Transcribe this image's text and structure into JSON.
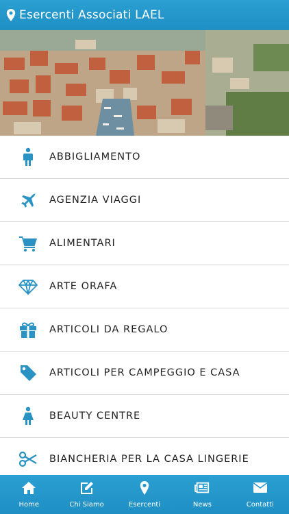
{
  "header": {
    "title": "Esercenti Associati LAEL",
    "icon": "map-marker-icon"
  },
  "hero": {
    "image": "aerial-town-photo"
  },
  "colors": {
    "accent": "#2399cf",
    "icon": "#2a93c4",
    "text": "#222222"
  },
  "categories": [
    {
      "label": "ABBIGLIAMENTO",
      "icon": "person-icon"
    },
    {
      "label": "AGENZIA VIAGGI",
      "icon": "airplane-icon"
    },
    {
      "label": "ALIMENTARI",
      "icon": "shopping-cart-icon"
    },
    {
      "label": "ARTE ORAFA",
      "icon": "diamond-icon"
    },
    {
      "label": "ARTICOLI DA REGALO",
      "icon": "gift-icon"
    },
    {
      "label": "ARTICOLI PER CAMPEGGIO E CASA",
      "icon": "tag-icon"
    },
    {
      "label": "BEAUTY CENTRE",
      "icon": "woman-icon"
    },
    {
      "label": "BIANCHERIA PER LA CASA LINGERIE",
      "icon": "scissors-icon"
    }
  ],
  "tabs": [
    {
      "label": "Home",
      "icon": "home-icon"
    },
    {
      "label": "Chi Siamo",
      "icon": "edit-icon"
    },
    {
      "label": "Esercenti",
      "icon": "map-marker-icon"
    },
    {
      "label": "News",
      "icon": "newspaper-icon"
    },
    {
      "label": "Contatti",
      "icon": "envelope-icon"
    }
  ]
}
